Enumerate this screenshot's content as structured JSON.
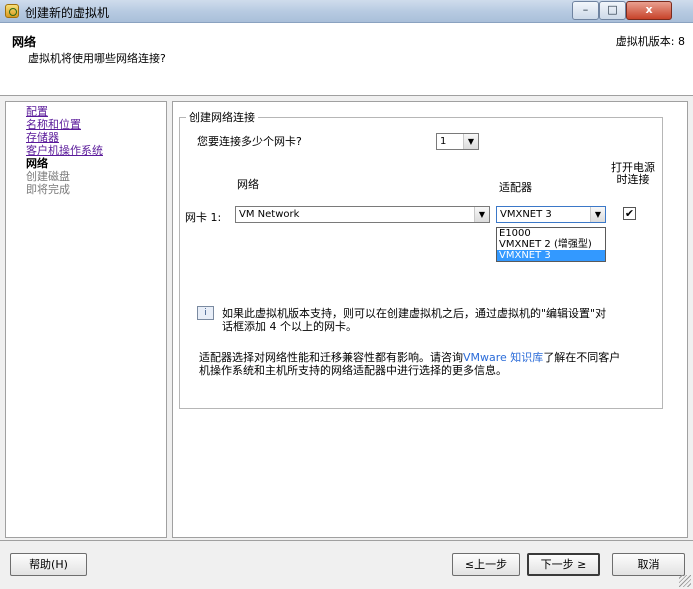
{
  "window": {
    "title": "创建新的虚拟机",
    "controls": {
      "minimize": "–",
      "maximize": "□",
      "close": "x"
    },
    "icon": "vm-wizard-icon"
  },
  "header": {
    "title": "网络",
    "subtitle": "虚拟机将使用哪些网络连接?",
    "version": "虚拟机版本: 8"
  },
  "sidebar": {
    "items": [
      {
        "label": "配置",
        "state": "link"
      },
      {
        "label": "名称和位置",
        "state": "link"
      },
      {
        "label": "存储器",
        "state": "link"
      },
      {
        "label": "客户机操作系统",
        "state": "link"
      },
      {
        "label": "网络",
        "state": "active"
      },
      {
        "label": "创建磁盘",
        "state": "disabled"
      },
      {
        "label": "即将完成",
        "state": "disabled"
      }
    ]
  },
  "network": {
    "group_label": "创建网络连接",
    "nic_count_question": "您要连接多少个网卡?",
    "nic_count_value": "1",
    "col_network": "网络",
    "col_adapter": "适配器",
    "col_power_on_1": "打开电源",
    "col_power_on_2": "时连接",
    "nic_label": "网卡 1:",
    "nic_network_value": "VM Network",
    "nic_adapter_value": "VMXNET 3",
    "connect_at_power_on": true,
    "check_mark": "✔",
    "adapter_options": [
      "E1000",
      "VMXNET 2 (增强型)",
      "VMXNET 3"
    ],
    "adapter_selected_index": 2,
    "info_note_line1": "如果此虚拟机版本支持，则可以在创建虚拟机之后，通过虚拟机的\"编辑设置\"对",
    "info_note_line2": "话框添加 4 个以上的网卡。",
    "adapter_note_prefix": "适配器选择对网络性能和迁移兼容性都有影响。请咨询",
    "adapter_note_link": "VMware 知识库",
    "adapter_note_suffix": "了解在不同客户",
    "adapter_note_line2": "机操作系统和主机所支持的网络适配器中进行选择的更多信息。"
  },
  "footer": {
    "help": "帮助(H)",
    "back": "≤上一步",
    "next": "下一步 ≥",
    "cancel": "取消"
  },
  "colors": {
    "link": "#5a1a9a",
    "kb_link": "#2a6bd8",
    "selection": "#3399ff"
  }
}
